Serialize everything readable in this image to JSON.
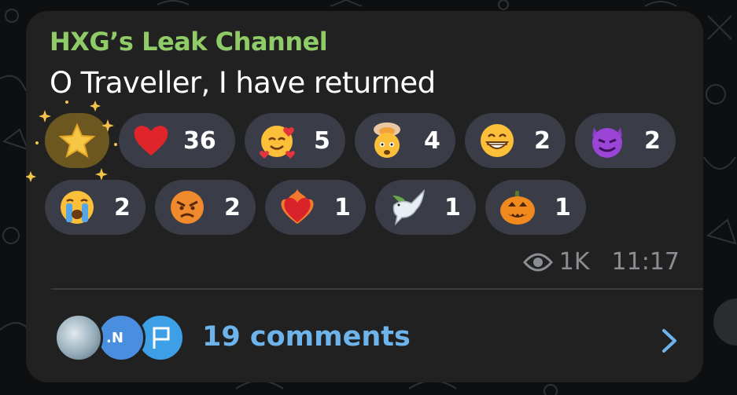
{
  "message": {
    "channel_name": "HXG’s Leak Channel",
    "text": "O Traveller, I have returned",
    "views": "1K",
    "time": "11:17"
  },
  "reactions": [
    {
      "icon": "star-icon",
      "count": ""
    },
    {
      "icon": "red-heart-icon",
      "count": "36"
    },
    {
      "icon": "smiling-face-with-hearts-icon",
      "count": "5"
    },
    {
      "icon": "exploding-head-icon",
      "count": "4"
    },
    {
      "icon": "grinning-face-icon",
      "count": "2"
    },
    {
      "icon": "smiling-devil-icon",
      "count": "2"
    },
    {
      "icon": "crying-face-icon",
      "count": "2"
    },
    {
      "icon": "angry-face-icon",
      "count": "2"
    },
    {
      "icon": "heart-on-fire-icon",
      "count": "1"
    },
    {
      "icon": "dove-icon",
      "count": "1"
    },
    {
      "icon": "jack-o-lantern-icon",
      "count": "1"
    }
  ],
  "comments": {
    "label": "19 comments",
    "avatar_initials": ".N"
  },
  "colors": {
    "background": "#0e0f10",
    "bubble": "#212121",
    "channel_name": "#8fcc67",
    "pill": "#3a3d47",
    "star_pill": "#6c5720",
    "link": "#6db3ec",
    "meta": "#8a8d92"
  }
}
